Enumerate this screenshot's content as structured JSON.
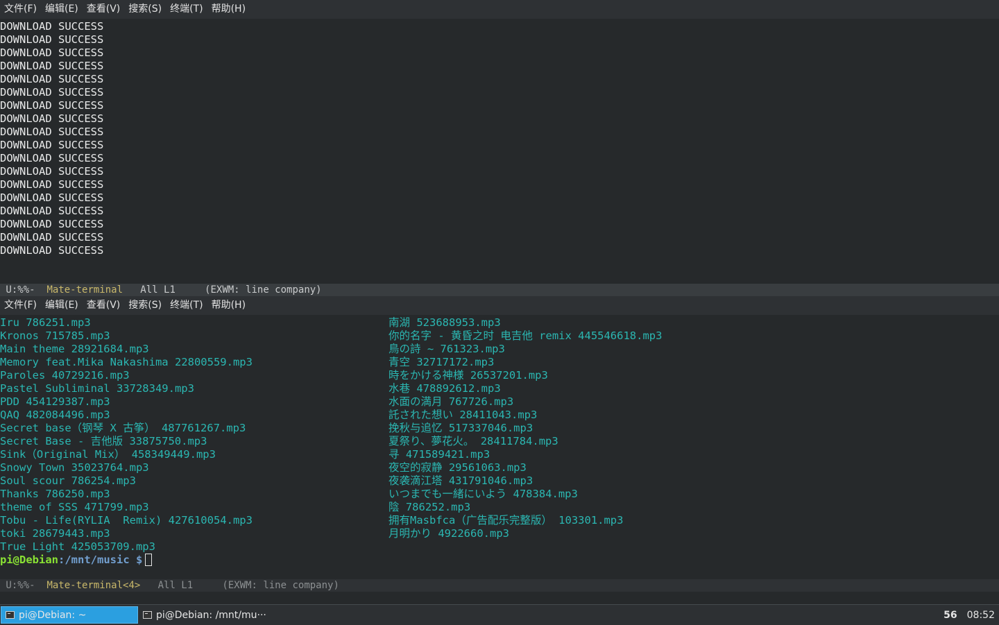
{
  "top_terminal": {
    "menu": [
      "文件(F)",
      "编辑(E)",
      "查看(V)",
      "搜索(S)",
      "终端(T)",
      "帮助(H)"
    ],
    "lines": [
      "DOWNLOAD SUCCESS",
      "DOWNLOAD SUCCESS",
      "DOWNLOAD SUCCESS",
      "DOWNLOAD SUCCESS",
      "DOWNLOAD SUCCESS",
      "DOWNLOAD SUCCESS",
      "DOWNLOAD SUCCESS",
      "DOWNLOAD SUCCESS",
      "DOWNLOAD SUCCESS",
      "DOWNLOAD SUCCESS",
      "DOWNLOAD SUCCESS",
      "DOWNLOAD SUCCESS",
      "DOWNLOAD SUCCESS",
      "DOWNLOAD SUCCESS",
      "DOWNLOAD SUCCESS",
      "DOWNLOAD SUCCESS",
      "DOWNLOAD SUCCESS",
      "DOWNLOAD SUCCESS"
    ],
    "modeline": {
      "state": " U:%%-  ",
      "buffer": "Mate-terminal",
      "position": "   All L1     ",
      "mode": "(EXWM: line company)"
    }
  },
  "bottom_terminal": {
    "menu": [
      "文件(F)",
      "编辑(E)",
      "查看(V)",
      "搜索(S)",
      "终端(T)",
      "帮助(H)"
    ],
    "left_files": [
      "Iru 786251.mp3",
      "Kronos 715785.mp3",
      "Main theme 28921684.mp3",
      "Memory feat.Mika Nakashima 22800559.mp3",
      "Paroles 40729216.mp3",
      "Pastel Subliminal 33728349.mp3",
      "PDD 454129387.mp3",
      "QAQ 482084496.mp3",
      "Secret base（钢琴 X 古筝） 487761267.mp3",
      "Secret Base - 吉他版 33875750.mp3",
      "Sink（Original Mix） 458349449.mp3",
      "Snowy Town 35023764.mp3",
      "Soul scour 786254.mp3",
      "Thanks 786250.mp3",
      "theme of SSS 471799.mp3",
      "Tobu - Life(RYLIA  Remix) 427610054.mp3",
      "toki 28679443.mp3",
      "True Light 425053709.mp3"
    ],
    "right_files": [
      "南湖 523688953.mp3",
      "你的名字 - 黄昏之时 电吉他 remix 445546618.mp3",
      "鳥の詩 ~ 761323.mp3",
      "青空 32717172.mp3",
      "時をかける神様 26537201.mp3",
      "水巷 478892612.mp3",
      "水面の満月 767726.mp3",
      "託された想い 28411043.mp3",
      "挽秋与追忆 517337046.mp3",
      "夏祭り、夢花火。 28411784.mp3",
      "寻 471589421.mp3",
      "夜空的寂静 29561063.mp3",
      "夜袭滴江塔 431791046.mp3",
      "いつまでも一緒にいよう 478384.mp3",
      "陰 786252.mp3",
      "拥有Masbfca（广告配乐完整版） 103301.mp3",
      "月明かり 4922660.mp3"
    ],
    "prompt": {
      "user": "pi@Debian",
      "path": ":/mnt/music",
      "symbol": " $"
    },
    "modeline": {
      "state": " U:%%-  ",
      "buffer": "Mate-terminal<4>",
      "position": "   All L1     ",
      "mode": "(EXWM: line company)"
    }
  },
  "taskbar": {
    "tasks": [
      {
        "label": "pi@Debian: ~",
        "active": true
      },
      {
        "label": "pi@Debian: /mnt/mu···",
        "active": false
      }
    ],
    "indicator": "56",
    "clock": "08:52"
  },
  "colors": {
    "file_text": "#2bb7b2",
    "prompt_user": "#8ae234",
    "prompt_path": "#729fcf",
    "modeline_buffer": "#c9b86a",
    "task_active": "#2b9fe0"
  }
}
